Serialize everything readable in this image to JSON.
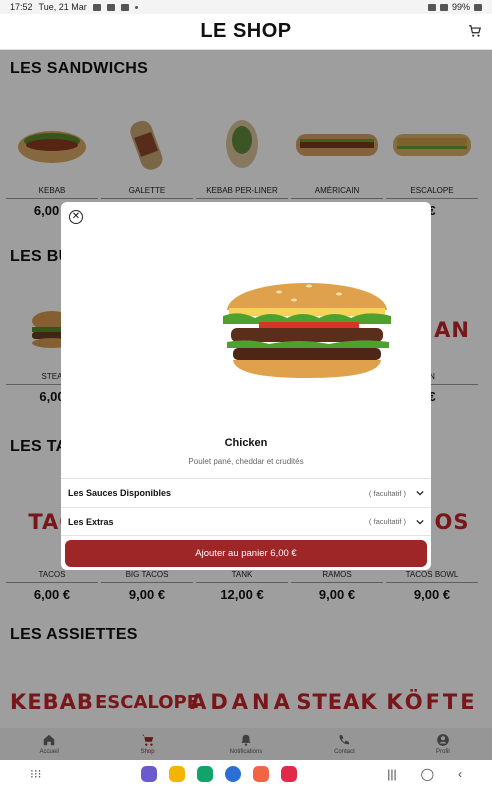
{
  "status": {
    "time": "17:52",
    "date": "Tue, 21 Mar",
    "battery": "99%"
  },
  "header": {
    "title": "LE SHOP"
  },
  "sections": {
    "sandwichs": {
      "title": "LES SANDWICHS",
      "items": [
        {
          "name": "KEBAB",
          "price": "6,00 €"
        },
        {
          "name": "GALETTE",
          "price": ""
        },
        {
          "name": "KEBAB PER-LINER",
          "price": ""
        },
        {
          "name": "AMÉRICAIN",
          "price": ""
        },
        {
          "name": "ESCALOPE",
          "price": "€"
        }
      ]
    },
    "burgers": {
      "title": "LES BU",
      "items": [
        {
          "name": "STEA",
          "price": "6,00"
        },
        {
          "name": "",
          "price": ""
        },
        {
          "name": "",
          "price": ""
        },
        {
          "name": "",
          "price": ""
        },
        {
          "name": "N",
          "price": "€"
        }
      ]
    },
    "tacos": {
      "title": "LES TA",
      "items": [
        {
          "name": "TACOS",
          "price": "6,00 €",
          "word": "TAC"
        },
        {
          "name": "BIG TACOS",
          "price": "9,00 €",
          "word": ""
        },
        {
          "name": "TANK",
          "price": "12,00 €",
          "word": ""
        },
        {
          "name": "RAMOS",
          "price": "9,00 €",
          "word": ""
        },
        {
          "name": "TACOS BOWL",
          "price": "9,00 €",
          "word": "OS"
        }
      ]
    },
    "assiettes": {
      "title": "LES ASSIETTES",
      "items": [
        {
          "word": "KEBAB"
        },
        {
          "word": "ESCALOPE"
        },
        {
          "word": "ADANA"
        },
        {
          "word": "STEAK"
        },
        {
          "word": "KÖFTE"
        }
      ]
    }
  },
  "modal": {
    "product_name": "Chicken",
    "description": "Poulet pané, cheddar et crudités",
    "options": [
      {
        "label": "Les Sauces Disponibles",
        "note": "( facultatif )"
      },
      {
        "label": "Les Extras",
        "note": "( facultatif )"
      }
    ],
    "add_button": "Ajouter au panier 6,00 €"
  },
  "bottom_nav": [
    {
      "label": "Accueil",
      "icon": "home-icon"
    },
    {
      "label": "Shop",
      "icon": "cart-icon"
    },
    {
      "label": "Notifications",
      "icon": "bell-icon"
    },
    {
      "label": "Contact",
      "icon": "phone-icon"
    },
    {
      "label": "Profil",
      "icon": "profile-icon"
    }
  ],
  "colors": {
    "accent": "#9e2626",
    "word_red": "#c0262b"
  }
}
